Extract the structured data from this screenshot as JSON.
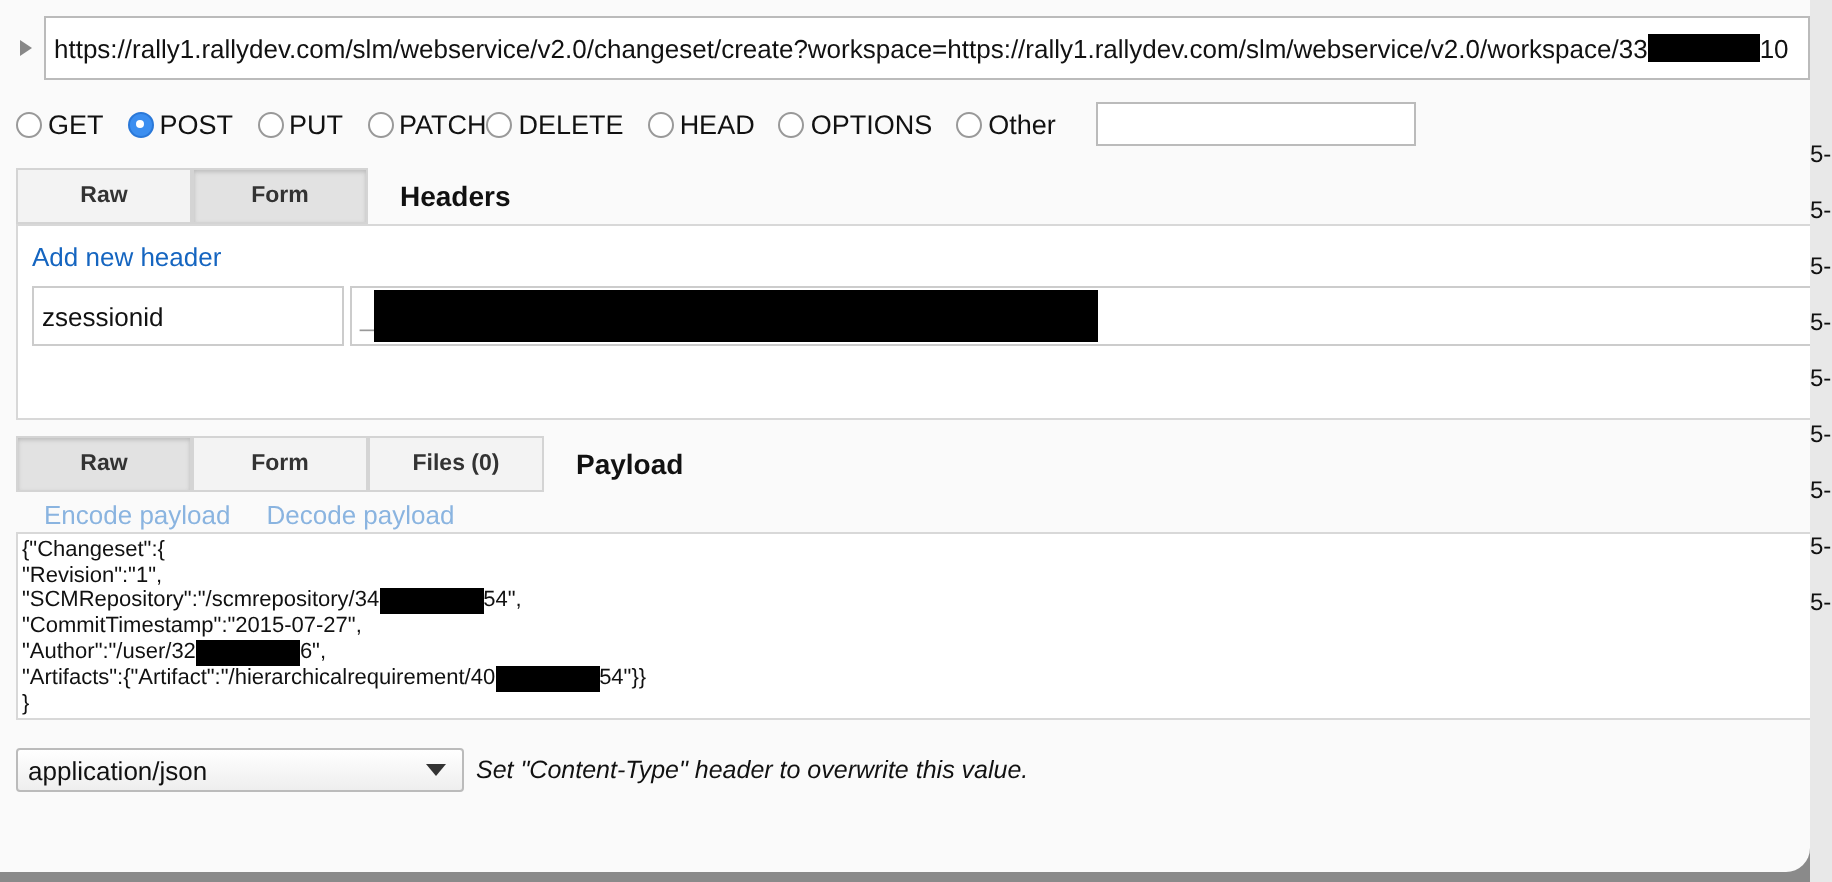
{
  "url": {
    "segments": [
      {
        "kind": "text",
        "text": "https://rally1.rallydev.com/slm/webservice/v2.0/changeset/create?workspace=https://rally1.rallydev.com/slm/webservice/v2.0/workspace/33"
      },
      {
        "kind": "redacted"
      },
      {
        "kind": "text",
        "text": "10"
      }
    ]
  },
  "methods": [
    {
      "label": "GET",
      "selected": false
    },
    {
      "label": "POST",
      "selected": true
    },
    {
      "label": "PUT",
      "selected": false
    },
    {
      "label": "PATCH",
      "selected": false
    },
    {
      "label": "DELETE",
      "selected": false
    },
    {
      "label": "HEAD",
      "selected": false
    },
    {
      "label": "OPTIONS",
      "selected": false
    },
    {
      "label": "Other",
      "selected": false
    }
  ],
  "headers": {
    "tabs": [
      {
        "label": "Raw",
        "selected": false
      },
      {
        "label": "Form",
        "selected": true
      }
    ],
    "title": "Headers",
    "add_link": "Add new header",
    "rows": [
      {
        "name": "zsessionid",
        "value": [
          {
            "kind": "text",
            "text": "_"
          },
          {
            "kind": "redacted"
          }
        ]
      }
    ]
  },
  "payload": {
    "tabs": [
      {
        "label": "Raw",
        "selected": true
      },
      {
        "label": "Form",
        "selected": false
      },
      {
        "label": "Files (0)",
        "selected": false
      }
    ],
    "title": "Payload",
    "links": [
      "Encode payload",
      "Decode payload"
    ],
    "lines": [
      [
        {
          "kind": "text",
          "text": "{\"Changeset\":{"
        }
      ],
      [
        {
          "kind": "text",
          "text": "\"Revision\":\"1\","
        }
      ],
      [
        {
          "kind": "text",
          "text": "\"SCMRepository\":\"/scmrepository/34"
        },
        {
          "kind": "redacted"
        },
        {
          "kind": "text",
          "text": "54\","
        }
      ],
      [
        {
          "kind": "text",
          "text": "\"CommitTimestamp\":\"2015-07-27\","
        }
      ],
      [
        {
          "kind": "text",
          "text": "\"Author\":\"/user/32"
        },
        {
          "kind": "redacted"
        },
        {
          "kind": "text",
          "text": "6\","
        }
      ],
      [
        {
          "kind": "text",
          "text": "\"Artifacts\":{\"Artifact\":\"/hierarchicalrequirement/40"
        },
        {
          "kind": "redacted"
        },
        {
          "kind": "text",
          "text": "54\"}}"
        }
      ],
      [
        {
          "kind": "text",
          "text": "}"
        }
      ]
    ],
    "content_type": "application/json",
    "hint": "Set \"Content-Type\" header to overwrite this value."
  },
  "background_cells": [
    "5-",
    "5-",
    "5-",
    "5-",
    "5-",
    "5-",
    "5-",
    "5-",
    "5-"
  ]
}
